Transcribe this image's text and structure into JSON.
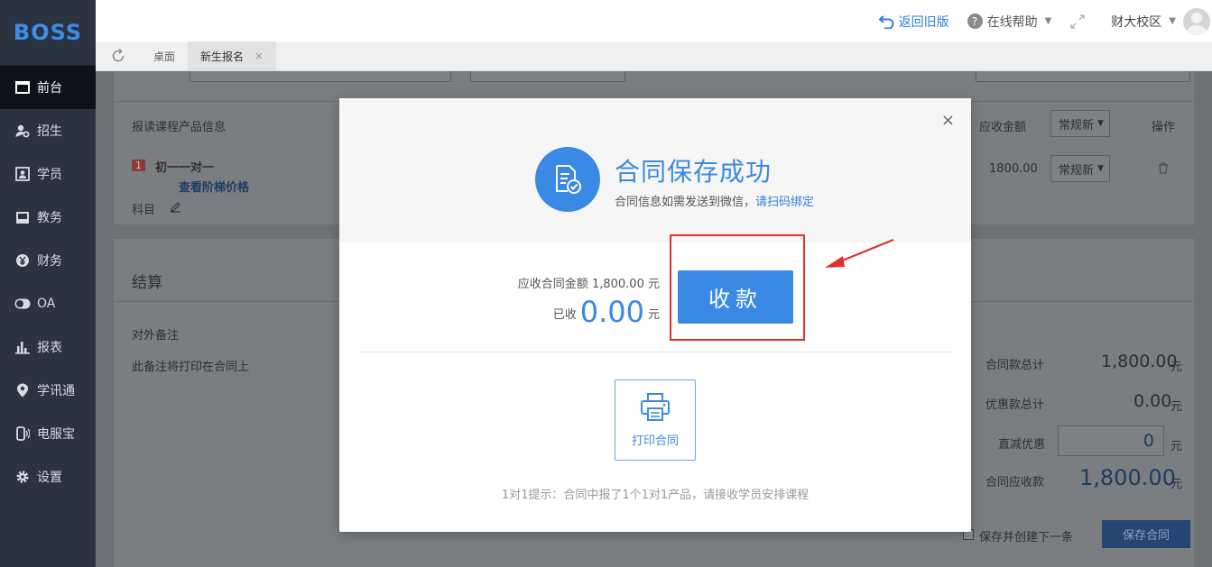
{
  "brand": {
    "logo_text": "BOSS",
    "accent": "#3a89e4"
  },
  "sidebar": {
    "items": [
      {
        "label": "前台",
        "icon": "monitor-icon",
        "active": true
      },
      {
        "label": "招生",
        "icon": "user-add-icon",
        "active": false
      },
      {
        "label": "学员",
        "icon": "id-card-icon",
        "active": false
      },
      {
        "label": "教务",
        "icon": "book-icon",
        "active": false
      },
      {
        "label": "财务",
        "icon": "yen-icon",
        "active": false
      },
      {
        "label": "OA",
        "icon": "toggle-icon",
        "active": false
      },
      {
        "label": "报表",
        "icon": "bar-chart-icon",
        "active": false
      },
      {
        "label": "学讯通",
        "icon": "location-icon",
        "active": false
      },
      {
        "label": "电服宝",
        "icon": "phone-icon",
        "active": false
      },
      {
        "label": "设置",
        "icon": "gear-icon",
        "active": false
      }
    ]
  },
  "header": {
    "back_old": "返回旧版",
    "help": "在线帮助",
    "school": "财大校区"
  },
  "tabs": [
    {
      "label": "桌面",
      "active": false
    },
    {
      "label": "新生报名",
      "active": true,
      "close": "×"
    }
  ],
  "background": {
    "course_table": {
      "col_product": "报读课程产品信息",
      "col_amount": "应收金额",
      "col_type": "常规新",
      "col_op": "操作",
      "row_index": "1",
      "row_name": "初一一对一",
      "row_link": "查看阶梯价格",
      "row_subject": "科目",
      "row_amount": "1800.00",
      "row_type": "常规新"
    },
    "settlement": {
      "title": "结算",
      "remark_label": "对外备注",
      "remark_hint": "此备注将打印在合同上",
      "contract_total_label": "合同款总计",
      "contract_total": "1,800.00",
      "discount_total_label": "优惠款总计",
      "discount_total": "0.00",
      "direct_discount_label": "直减优惠",
      "direct_discount": "0",
      "receivable_label": "合同应收款",
      "receivable": "1,800.00",
      "unit": "元",
      "save_new_label": "保存并创建下一条",
      "save_button": "保存合同"
    }
  },
  "modal": {
    "title": "合同保存成功",
    "subtitle": "合同信息如需发送到微信，",
    "subtitle_link": "请扫码绑定",
    "due_label": "应收合同金额",
    "due_amount": "1,800.00",
    "unit": "元",
    "paid_label": "已收",
    "paid_amount": "0.00",
    "pay_button": "收款",
    "print_button": "打印合同",
    "tip": "1对1提示：合同中报了1个1对1产品，请接收学员安排课程",
    "close": "×"
  }
}
